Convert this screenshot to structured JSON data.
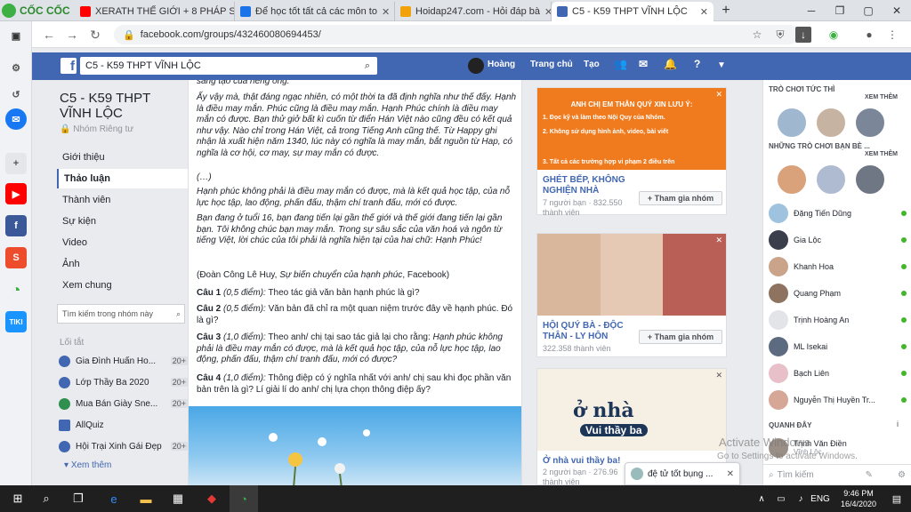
{
  "browser": {
    "brand": "CỐC CỐC",
    "tabs": [
      {
        "label": "XERATH THẾ GIỚI + 8 PHÁP S",
        "color": "#ff0000"
      },
      {
        "label": "Để học tốt tất cả các môn to",
        "color": "#1a73e8"
      },
      {
        "label": "Hoidap247.com - Hỏi đáp bà",
        "color": "#f2a20c"
      },
      {
        "label": "C5 - K59 THPT VĨNH LỘC",
        "color": "#4267b2"
      }
    ],
    "new_tab": "+",
    "url": "facebook.com/groups/432460080694453/"
  },
  "facebook": {
    "search_value": "C5 - K59 THPT VĨNH LỘC",
    "user_name": "Hoàng",
    "nav_home": "Trang chủ",
    "nav_create": "Tạo"
  },
  "group": {
    "title": "C5 - K59 THPT VĨNH LỘC",
    "privacy": "Nhóm Riêng tư",
    "nav": [
      "Giới thiệu",
      "Thảo luận",
      "Thành viên",
      "Sự kiện",
      "Video",
      "Ảnh",
      "Xem chung"
    ],
    "search_placeholder": "Tìm kiếm trong nhóm này",
    "shortcuts_title": "Lối tắt",
    "shortcuts": [
      {
        "label": "Gia Đình Huấn Ho...",
        "badge": "20+"
      },
      {
        "label": "Lớp Thầy Ba 2020",
        "badge": "20+"
      },
      {
        "label": "Mua Bán Giày Sne...",
        "badge": "20+"
      },
      {
        "label": "AllQuiz",
        "badge": ""
      },
      {
        "label": "Hội Trại Xinh Gái Đẹp",
        "badge": "20+"
      }
    ],
    "see_more": "Xem thêm"
  },
  "post": {
    "top_cut": "sáng tạo của riêng ông.",
    "para1": "Ấy vậy mà, thật đáng ngạc nhiên, có một thời ta đã định nghĩa như thế đấy. Hạnh là điều may mắn. Phúc cũng là điều may mắn. Hạnh Phúc chính là điều may mắn có được. Bạn thử giở bất kì cuốn từ điển Hán Việt nào cũng đều có kết quả như vậy. Nào chỉ trong Hán Việt, cả trong Tiếng Anh cũng thế. Từ Happy ghi nhận là xuất hiện năm 1340, lúc này có nghĩa là may mắn, bắt nguồn từ Hap, có nghĩa là cơ hội, cơ may, sự may mắn có được.",
    "ellipsis": "(…)",
    "para2": "Hạnh phúc không phải là điều may mắn có được, mà là kết quả học tập, của nỗ lực học tập, lao động, phấn đấu, thậm chí tranh đấu, mới có được.",
    "para3": "Bạn đang ở tuổi 16, bạn đang tiến lại gần thế giới và thế giới đang tiến lại gần bạn. Tôi không chúc bạn may mắn. Trong sự sâu sắc của văn hoá và ngôn từ tiếng Việt, lời chúc của tôi phải là nghĩa hiện tại của hai chữ: Hạnh Phúc!",
    "source_prefix": "(Đoàn Công Lê Huy, ",
    "source_title": "Sự biến chuyển của hạnh phúc",
    "source_suffix": ", Facebook)",
    "questions": [
      {
        "num": "Câu 1",
        "pts": "(0,5 điểm):",
        "text": "Theo tác giả văn bản hạnh phúc là gì?"
      },
      {
        "num": "Câu 2",
        "pts": "(0,5 điểm):",
        "text": "Văn bản đã chỉ ra một quan niệm trước đây về hạnh phúc. Đó là gì?"
      },
      {
        "num": "Câu 3",
        "pts": "(1,0 điểm):",
        "text": "Theo anh/ chị tại sao tác giả lại cho rằng: ",
        "italic": "Hạnh phúc không phải là điều may mắn có được, mà là kết quả học tập, của nỗ lực học tập, lao động, phấn đấu, thậm chí tranh đấu, mới có được?"
      },
      {
        "num": "Câu 4",
        "pts": "(1,0 điểm):",
        "text": "Thông điệp có ý nghĩa nhất với anh/ chị sau khi đọc phần văn bản trên là gì? Lí giải lí do anh/ chị lựa chọn thông điệp ấy?"
      }
    ]
  },
  "suggestions": {
    "card1": {
      "banner_title": "ANH CHỊ EM THÂN QUÝ XIN LƯU Ý:",
      "rule1": "1. Đọc kỹ và làm theo Nội Quy của Nhóm.",
      "rule2": "2. Không sử dụng hình ảnh, video, bài viết",
      "rule3": "3. Tất cả các trường hợp vi phạm 2 điều trên",
      "name": "GHÉT BẾP, KHÔNG NGHIỆN NHÀ",
      "meta1": "7 người bạn · 832.550",
      "meta2": "thành viên",
      "join": "Tham gia nhóm"
    },
    "card2": {
      "name": "HỘI QUÝ BÀ - ĐỘC THÂN - LY HÔN",
      "meta1": "322.358 thành viên",
      "join": "Tham gia nhóm"
    },
    "card3": {
      "banner_title": "ở nhà",
      "banner_sub": "Vui thầy ba",
      "name": "Ở nhà vui thầy ba!",
      "meta1": "2 người bạn · 276.96",
      "meta2": "thành viên"
    }
  },
  "chat": {
    "instant_games": "TRÒ CHƠI TỨC THÌ",
    "see_more": "XEM THÊM",
    "friends_games": "NHỮNG TRÒ CHƠI BẠN BÈ ...",
    "see_more2": "XEM THÊM",
    "contacts": [
      "Đặng Tiến Dũng",
      "Gia Lộc",
      "Khanh Hoa",
      "Quang Phạm",
      "Trịnh Hoàng An",
      "ML Isekai",
      "Bạch Liên",
      "Nguyễn Thị Huyền Tr..."
    ],
    "recent_title": "QUANH ĐÂY",
    "recent_contact": "Trịnh Văn Điền",
    "recent_sub": "Vĩnh Lộc",
    "search_placeholder": "Tìm kiếm",
    "popup": "đệ tử tốt bụng ..."
  },
  "overlay": {
    "activate_title": "Activate Windows",
    "activate_sub": "Go to Settings to activate Windows."
  },
  "taskbar": {
    "lang": "ENG",
    "time": "9:46 PM",
    "date": "16/4/2020"
  }
}
